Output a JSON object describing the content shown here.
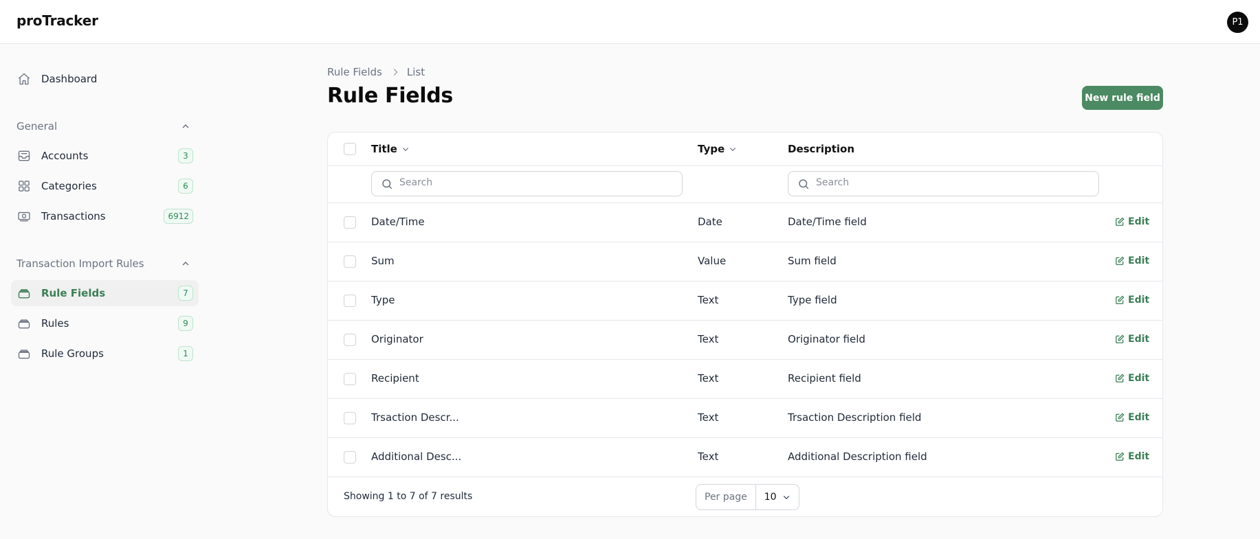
{
  "app": {
    "brand": "proTracker",
    "avatar_initials": "P1"
  },
  "colors": {
    "accent": "#4b8a62",
    "accent_text": "#3b7f56",
    "badge_border": "#bfe3cd",
    "badge_bg": "#f0faf4"
  },
  "sidebar": {
    "dashboard": {
      "label": "Dashboard",
      "icon": "home-icon"
    },
    "groups": [
      {
        "label": "General",
        "items": [
          {
            "label": "Accounts",
            "badge": "3",
            "icon": "inbox-icon"
          },
          {
            "label": "Categories",
            "badge": "6",
            "icon": "grid-icon"
          },
          {
            "label": "Transactions",
            "badge": "6912",
            "icon": "banknote-icon"
          }
        ]
      },
      {
        "label": "Transaction Import Rules",
        "items": [
          {
            "label": "Rule Fields",
            "badge": "7",
            "icon": "stack-icon",
            "active": true
          },
          {
            "label": "Rules",
            "badge": "9",
            "icon": "stack-icon"
          },
          {
            "label": "Rule Groups",
            "badge": "1",
            "icon": "stack-icon"
          }
        ]
      }
    ]
  },
  "breadcrumb": {
    "parent": "Rule Fields",
    "current": "List"
  },
  "page": {
    "title": "Rule Fields",
    "new_button": "New rule field"
  },
  "table": {
    "columns": {
      "title": "Title",
      "type": "Type",
      "description": "Description"
    },
    "search_placeholder_title": "Search",
    "search_placeholder_description": "Search",
    "edit_label": "Edit",
    "rows": [
      {
        "title": "Date/Time",
        "type": "Date",
        "description": "Date/Time field"
      },
      {
        "title": "Sum",
        "type": "Value",
        "description": "Sum field"
      },
      {
        "title": "Type",
        "type": "Text",
        "description": "Type field"
      },
      {
        "title": "Originator",
        "type": "Text",
        "description": "Originator field"
      },
      {
        "title": "Recipient",
        "type": "Text",
        "description": "Recipient field"
      },
      {
        "title": "Trsaction Descr...",
        "type": "Text",
        "description": "Trsaction Description field"
      },
      {
        "title": "Additional Desc...",
        "type": "Text",
        "description": "Additional Description field"
      }
    ],
    "footer": {
      "summary": "Showing 1 to 7 of 7 results",
      "per_page_label": "Per page",
      "per_page_value": "10"
    }
  }
}
